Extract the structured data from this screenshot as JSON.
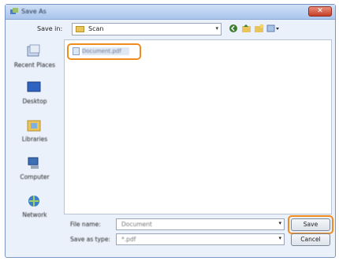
{
  "window": {
    "title": "Save As"
  },
  "toolbar": {
    "savein_label": "Save in:",
    "savein_value": "Scan",
    "back_icon": "back-icon",
    "up_icon": "up-folder-icon",
    "new_folder_icon": "new-folder-icon",
    "views_icon": "views-menu-icon"
  },
  "places": [
    {
      "label": "Recent Places",
      "icon": "recent-places-icon"
    },
    {
      "label": "Desktop",
      "icon": "desktop-icon"
    },
    {
      "label": "Libraries",
      "icon": "libraries-icon"
    },
    {
      "label": "Computer",
      "icon": "computer-icon"
    },
    {
      "label": "Network",
      "icon": "network-icon"
    }
  ],
  "files": [
    {
      "name": "Document.pdf"
    }
  ],
  "footer": {
    "filename_label": "File name:",
    "filename_value": "Document",
    "filetype_label": "Save as type:",
    "filetype_value": "*.pdf",
    "save_label": "Save",
    "cancel_label": "Cancel"
  },
  "colors": {
    "highlight": "#f08c1e",
    "close": "#c63d25"
  }
}
